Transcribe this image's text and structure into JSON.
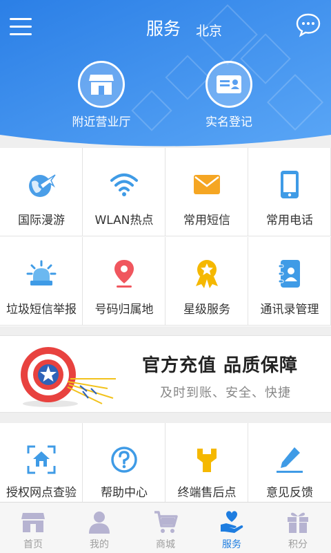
{
  "header": {
    "title": "服务",
    "city": "北京",
    "quick_actions": [
      {
        "label": "附近营业厅",
        "icon": "store-icon"
      },
      {
        "label": "实名登记",
        "icon": "id-card-icon"
      }
    ]
  },
  "services": [
    {
      "label": "国际漫游",
      "icon": "globe-plane-icon"
    },
    {
      "label": "WLAN热点",
      "icon": "wifi-icon"
    },
    {
      "label": "常用短信",
      "icon": "envelope-icon"
    },
    {
      "label": "常用电话",
      "icon": "phone-icon"
    },
    {
      "label": "垃圾短信举报",
      "icon": "alarm-light-icon"
    },
    {
      "label": "号码归属地",
      "icon": "location-pin-icon"
    },
    {
      "label": "星级服务",
      "icon": "star-medal-icon"
    },
    {
      "label": "通讯录管理",
      "icon": "contacts-book-icon"
    }
  ],
  "banner": {
    "headline": "官方充值 品质保障",
    "subline": "及时到账、安全、快捷"
  },
  "services2": [
    {
      "label": "授权网点查验",
      "icon": "home-scan-icon"
    },
    {
      "label": "帮助中心",
      "icon": "help-icon"
    },
    {
      "label": "终端售后点",
      "icon": "wrench-icon"
    },
    {
      "label": "意见反馈",
      "icon": "pencil-icon"
    }
  ],
  "tabs": [
    {
      "label": "首页",
      "icon": "store-icon"
    },
    {
      "label": "我的",
      "icon": "person-icon"
    },
    {
      "label": "商城",
      "icon": "cart-icon"
    },
    {
      "label": "服务",
      "icon": "hand-heart-icon",
      "active": true
    },
    {
      "label": "积分",
      "icon": "gift-icon"
    }
  ],
  "colors": {
    "header_blue": "#3a8ef0",
    "active_tab": "#1e7de0",
    "inactive_tab": "#b6b3d1"
  }
}
